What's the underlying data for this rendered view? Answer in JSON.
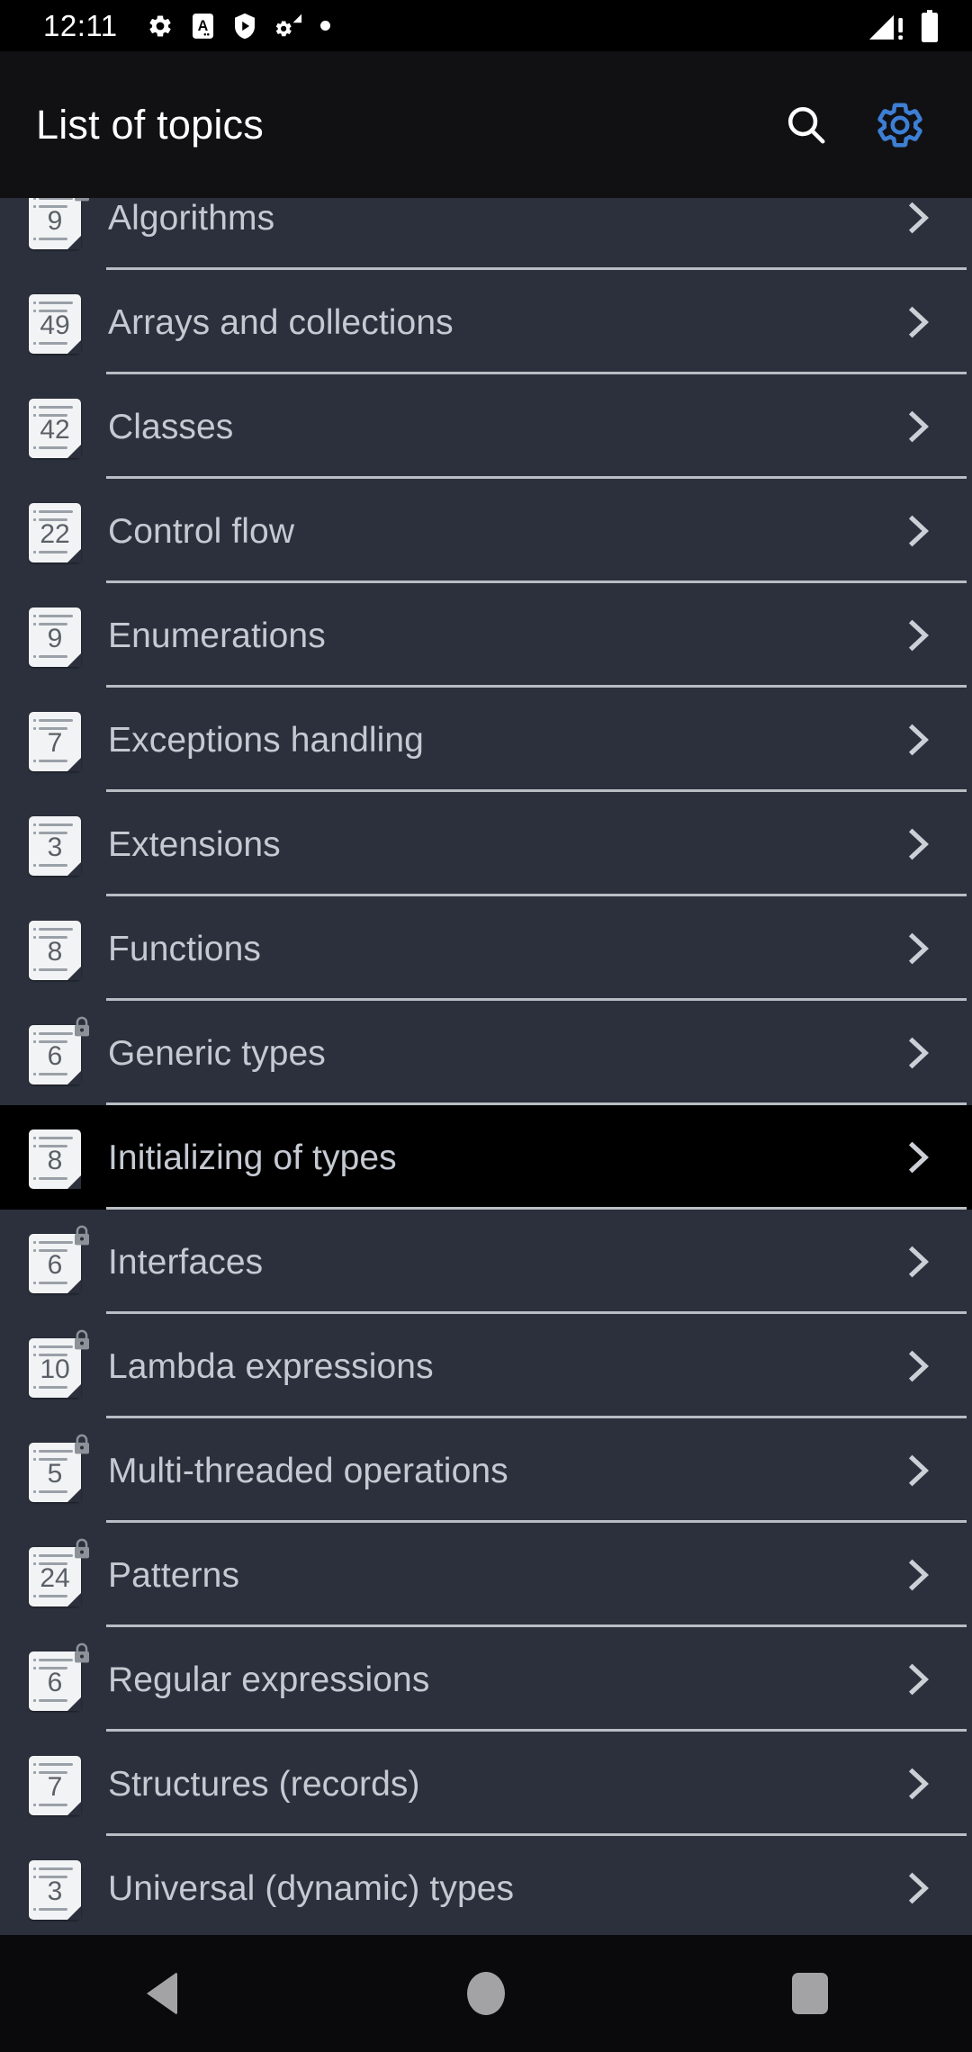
{
  "status_bar": {
    "time": "12:11",
    "left_icons": [
      "gear-icon",
      "text-box-a-icon",
      "shield-play-icon",
      "gear-signal-icon",
      "dot-icon"
    ],
    "right_icons": [
      "signal-no-service-icon",
      "battery-full-icon"
    ]
  },
  "app_bar": {
    "title": "List of topics",
    "search_label": "Search",
    "settings_label": "Settings",
    "settings_color": "#3d7fd4",
    "background": "#111114"
  },
  "theme": {
    "list_background": "#2b303c",
    "pressed_background": "#000000",
    "label_color": "#c5cad2",
    "divider_color": "#b9bdc4"
  },
  "list": {
    "items": [
      {
        "label": "Algorithms",
        "count": "9",
        "locked": true,
        "pressed": false
      },
      {
        "label": "Arrays and collections",
        "count": "49",
        "locked": false,
        "pressed": false
      },
      {
        "label": "Classes",
        "count": "42",
        "locked": false,
        "pressed": false
      },
      {
        "label": "Control flow",
        "count": "22",
        "locked": false,
        "pressed": false
      },
      {
        "label": "Enumerations",
        "count": "9",
        "locked": false,
        "pressed": false
      },
      {
        "label": "Exceptions handling",
        "count": "7",
        "locked": false,
        "pressed": false
      },
      {
        "label": "Extensions",
        "count": "3",
        "locked": false,
        "pressed": false
      },
      {
        "label": "Functions",
        "count": "8",
        "locked": false,
        "pressed": false
      },
      {
        "label": "Generic types",
        "count": "6",
        "locked": true,
        "pressed": false
      },
      {
        "label": "Initializing of types",
        "count": "8",
        "locked": false,
        "pressed": true
      },
      {
        "label": "Interfaces",
        "count": "6",
        "locked": true,
        "pressed": false
      },
      {
        "label": "Lambda expressions",
        "count": "10",
        "locked": true,
        "pressed": false
      },
      {
        "label": "Multi-threaded operations",
        "count": "5",
        "locked": true,
        "pressed": false
      },
      {
        "label": "Patterns",
        "count": "24",
        "locked": true,
        "pressed": false
      },
      {
        "label": "Regular expressions",
        "count": "6",
        "locked": true,
        "pressed": false
      },
      {
        "label": "Structures (records)",
        "count": "7",
        "locked": false,
        "pressed": false
      },
      {
        "label": "Universal (dynamic) types",
        "count": "3",
        "locked": false,
        "pressed": false
      }
    ]
  },
  "nav_bar": {
    "back_label": "Back",
    "home_label": "Home",
    "recents_label": "Recents"
  }
}
